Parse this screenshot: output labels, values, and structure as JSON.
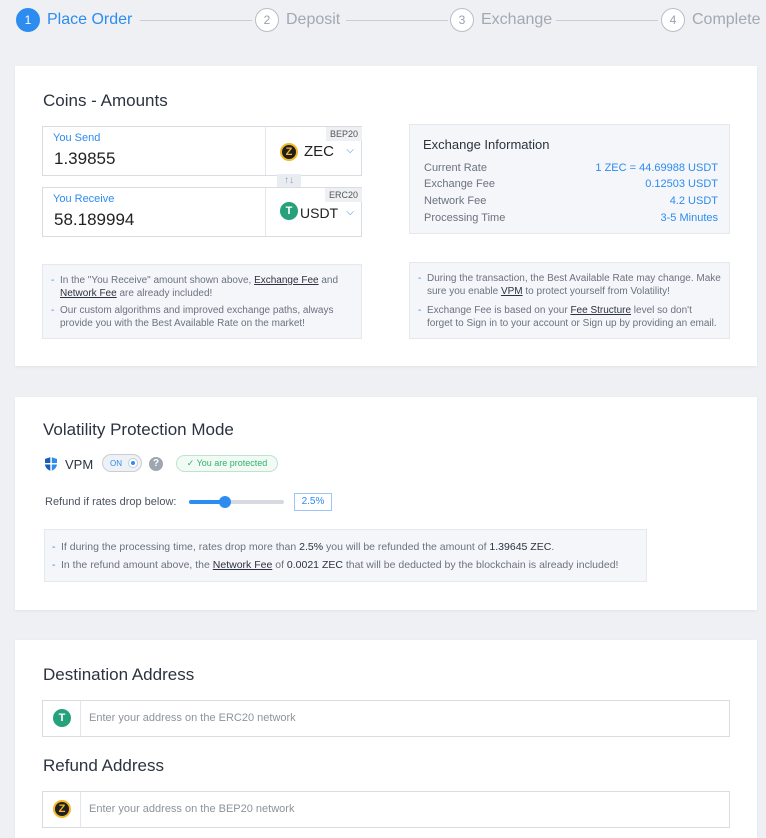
{
  "stepper": {
    "steps": [
      {
        "num": "1",
        "label": "Place Order"
      },
      {
        "num": "2",
        "label": "Deposit"
      },
      {
        "num": "3",
        "label": "Exchange"
      },
      {
        "num": "4",
        "label": "Complete"
      }
    ],
    "active_step": 1
  },
  "coins": {
    "title": "Coins - Amounts",
    "send": {
      "label": "You Send",
      "value": "1.39855",
      "coin": "ZEC",
      "network": "BEP20",
      "icon": "zec-icon"
    },
    "receive": {
      "label": "You Receive",
      "value": "58.189994",
      "coin": "USDT",
      "network": "ERC20",
      "icon": "usdt-icon"
    },
    "swap_glyph": "↑↓",
    "info": {
      "title": "Exchange Information",
      "rows": [
        {
          "label": "Current Rate",
          "value": "1 ZEC = 44.69988 USDT"
        },
        {
          "label": "Exchange Fee",
          "value": "0.12503 USDT"
        },
        {
          "label": "Network Fee",
          "value": "4.2 USDT"
        },
        {
          "label": "Processing Time",
          "value": "3-5 Minutes"
        }
      ]
    },
    "left_note": {
      "l1a": "In the \"You Receive\" amount shown above, ",
      "l1b": "Exchange Fee",
      "l1c": " and",
      "l2a": "Network Fee",
      "l2b": " are already included!",
      "l3": "Our custom algorithms and improved exchange paths, always",
      "l4": "provide you with the Best Available Rate on the market!"
    },
    "right_note": {
      "l1": "During the transaction, the Best Available Rate may change. Make",
      "l2a": "sure you enable ",
      "l2b": "VPM",
      "l2c": " to protect yourself from Volatility!",
      "l3a": "Exchange Fee is based on your ",
      "l3b": "Fee Structure",
      "l3c": " level so don't",
      "l4": "forget to Sign in to your account or Sign up by providing an email."
    }
  },
  "vpm": {
    "title": "Volatility Protection Mode",
    "label": "VPM",
    "toggle": "ON",
    "help": "?",
    "badge": "✓  You are protected",
    "refund_label": "Refund if rates drop below:",
    "slider_value": 0.375,
    "percent": "2.5%",
    "note": {
      "l1a": "If during the processing time, rates drop more than ",
      "l1b": "2.5%",
      "l1c": " you will be refunded the amount of ",
      "l1d": "1.39645 ZEC",
      "l1e": ".",
      "l2a": "In the refund amount above, the ",
      "l2b": "Network Fee",
      "l2c": " of ",
      "l2d": "0.0021 ZEC",
      "l2e": " that will be deducted by the blockchain is already included!"
    }
  },
  "address": {
    "dest_title": "Destination Address",
    "dest_placeholder": "Enter your address on the ERC20 network",
    "refund_title": "Refund Address",
    "refund_placeholder": "Enter your address on the BEP20 network"
  },
  "colors": {
    "accent": "#2d8cf0",
    "success": "#2fb36b",
    "zec": "#f4b728",
    "usdt": "#26a17b"
  }
}
